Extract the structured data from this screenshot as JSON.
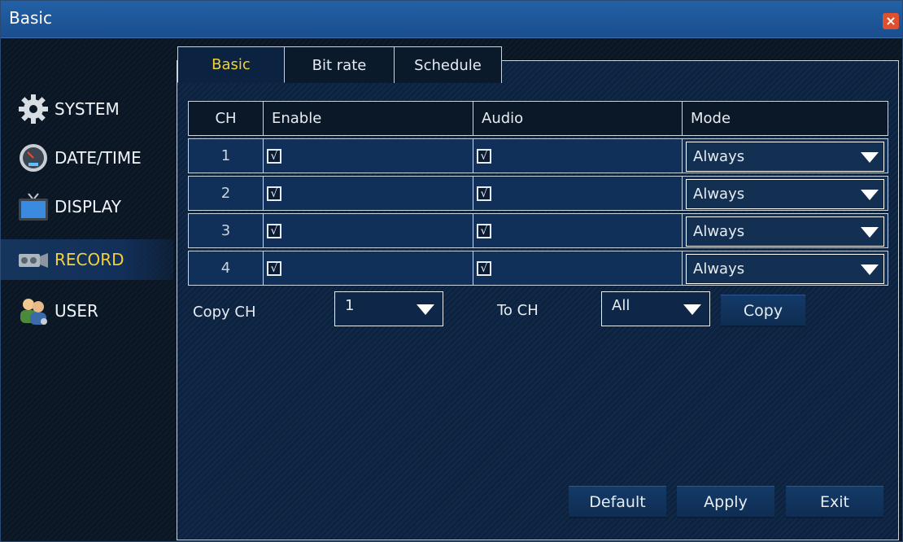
{
  "window": {
    "title": "Basic",
    "close_glyph": "×"
  },
  "sidebar": {
    "items": [
      {
        "label": "SYSTEM",
        "icon": "gear-icon",
        "active": false
      },
      {
        "label": "DATE/TIME",
        "icon": "clock-icon",
        "active": false
      },
      {
        "label": "DISPLAY",
        "icon": "monitor-icon",
        "active": false
      },
      {
        "label": "RECORD",
        "icon": "camera-icon",
        "active": true
      },
      {
        "label": "USER",
        "icon": "users-icon",
        "active": false
      }
    ]
  },
  "tabs": [
    {
      "label": "Basic",
      "active": true
    },
    {
      "label": "Bit rate",
      "active": false
    },
    {
      "label": "Schedule",
      "active": false
    }
  ],
  "table": {
    "headers": {
      "ch": "CH",
      "enable": "Enable",
      "audio": "Audio",
      "mode": "Mode"
    },
    "rows": [
      {
        "ch": "1",
        "enable": "√",
        "audio": "√",
        "mode": "Always"
      },
      {
        "ch": "2",
        "enable": "√",
        "audio": "√",
        "mode": "Always"
      },
      {
        "ch": "3",
        "enable": "√",
        "audio": "√",
        "mode": "Always"
      },
      {
        "ch": "4",
        "enable": "√",
        "audio": "√",
        "mode": "Always"
      }
    ]
  },
  "copy": {
    "copy_ch_label": "Copy CH",
    "copy_ch_value": "1",
    "to_ch_label": "To CH",
    "to_ch_value": "All",
    "copy_button": "Copy"
  },
  "buttons": {
    "default": "Default",
    "apply": "Apply",
    "exit": "Exit"
  },
  "colors": {
    "accent": "#f2d23a",
    "titlebar": "#2361a6",
    "panel": "#0b2240",
    "close": "#e0502c"
  }
}
